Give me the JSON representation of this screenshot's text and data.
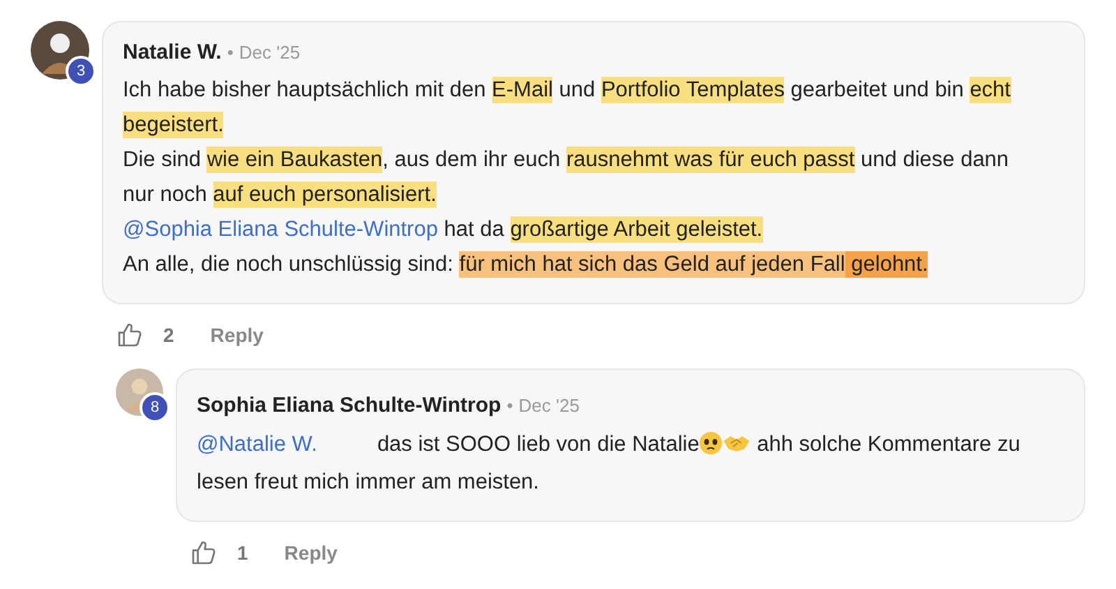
{
  "comments": [
    {
      "author": "Natalie W.",
      "separator": "•",
      "date": "Dec '25",
      "badge": "3",
      "likes": "2",
      "reply_label": "Reply",
      "indent": false,
      "paragraphs": [
        [
          {
            "kind": "text",
            "text": "Ich habe bisher hauptsächlich mit den "
          },
          {
            "kind": "highlight",
            "text": "E-Mail",
            "color": "#f9df80"
          },
          {
            "kind": "text",
            "text": " und "
          },
          {
            "kind": "highlight",
            "text": "Portfolio Templates",
            "color": "#f9df80"
          },
          {
            "kind": "text",
            "text": " gearbeitet und bin "
          },
          {
            "kind": "highlight",
            "text": "echt begeistert.",
            "color": "#f9df80"
          }
        ],
        [
          {
            "kind": "text",
            "text": "Die sind "
          },
          {
            "kind": "highlight",
            "text": "wie ein Baukasten",
            "color": "#f9df80"
          },
          {
            "kind": "text",
            "text": ", aus dem ihr euch "
          },
          {
            "kind": "highlight",
            "text": "rausnehmt was für euch passt",
            "color": "#f9df80"
          },
          {
            "kind": "text",
            "text": " und diese dann nur noch "
          },
          {
            "kind": "highlight",
            "text": "auf euch personalisiert.",
            "color": "#f9df80"
          }
        ],
        [
          {
            "kind": "mention",
            "text": "@Sophia Eliana Schulte-Wintrop"
          },
          {
            "kind": "text",
            "text": " hat da "
          },
          {
            "kind": "highlight",
            "text": "großartige Arbeit geleistet.",
            "color": "#f9df80"
          }
        ],
        [
          {
            "kind": "text",
            "text": "An alle, die noch unschlüssig sind: "
          },
          {
            "kind": "highlight",
            "text": "für mich hat sich das Geld auf jeden Fall",
            "color": "#f8c17e"
          },
          {
            "kind": "highlight",
            "text": " gelohnt.",
            "color": "#f5a24a"
          }
        ]
      ]
    },
    {
      "author": "Sophia Eliana Schulte-Wintrop",
      "separator": "•",
      "date": "Dec '25",
      "badge": "8",
      "likes": "1",
      "reply_label": "Reply",
      "indent": true,
      "paragraphs": [
        [
          {
            "kind": "mention",
            "text": "@Natalie W."
          },
          {
            "kind": "text",
            "text": "          das ist SOOO lieb von die Natalie"
          },
          {
            "kind": "face-emoji"
          },
          {
            "kind": "handshake-emoji"
          },
          {
            "kind": "text",
            "text": " ahh solche Kommentare zu lesen freut mich immer am meisten."
          }
        ]
      ]
    }
  ]
}
